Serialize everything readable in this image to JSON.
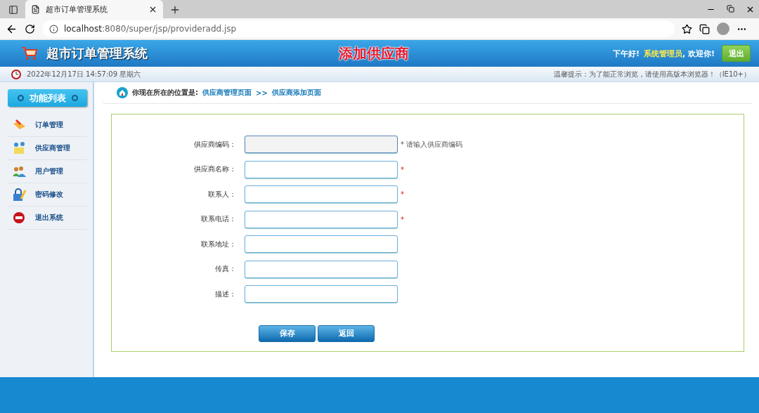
{
  "browser": {
    "tab_title": "超市订单管理系统",
    "url_host": "localhost",
    "url_rest": ":8080/super/jsp/provideradd.jsp"
  },
  "header": {
    "app_title": "超市订单管理系统",
    "page_title": "添加供应商",
    "greeting": "下午好!",
    "user": "系统管理员",
    "welcome": ", 欢迎你!",
    "logout": "退出"
  },
  "info_bar": {
    "datetime": "2022年12月17日 14:57:09 星期六",
    "tip": "温馨提示：为了能正常浏览，请使用高版本浏览器！（IE10+）"
  },
  "sidebar": {
    "title": "功能列表",
    "items": [
      {
        "label": "订单管理",
        "kind": "order"
      },
      {
        "label": "供应商管理",
        "kind": "provider"
      },
      {
        "label": "用户管理",
        "kind": "user"
      },
      {
        "label": "密码修改",
        "kind": "password"
      },
      {
        "label": "退出系统",
        "kind": "exit"
      }
    ]
  },
  "breadcrumb": {
    "prefix": "你现在所在的位置是:",
    "links": [
      "供应商管理页面",
      "供应商添加页面"
    ],
    "separator": ">>"
  },
  "form": {
    "fields": [
      {
        "label": "供应商编码：",
        "focused": true,
        "note": {
          "kind": "hint",
          "text": "* 请输入供应商编码"
        }
      },
      {
        "label": "供应商名称：",
        "focused": false,
        "note": {
          "kind": "required",
          "text": "*"
        }
      },
      {
        "label": "联系人：",
        "focused": false,
        "note": {
          "kind": "required",
          "text": "*"
        }
      },
      {
        "label": "联系电话：",
        "focused": false,
        "note": {
          "kind": "required",
          "text": "*"
        }
      },
      {
        "label": "联系地址：",
        "focused": false
      },
      {
        "label": "传真：",
        "focused": false
      },
      {
        "label": "描述：",
        "focused": false
      }
    ],
    "buttons": [
      "保存",
      "返回"
    ]
  }
}
